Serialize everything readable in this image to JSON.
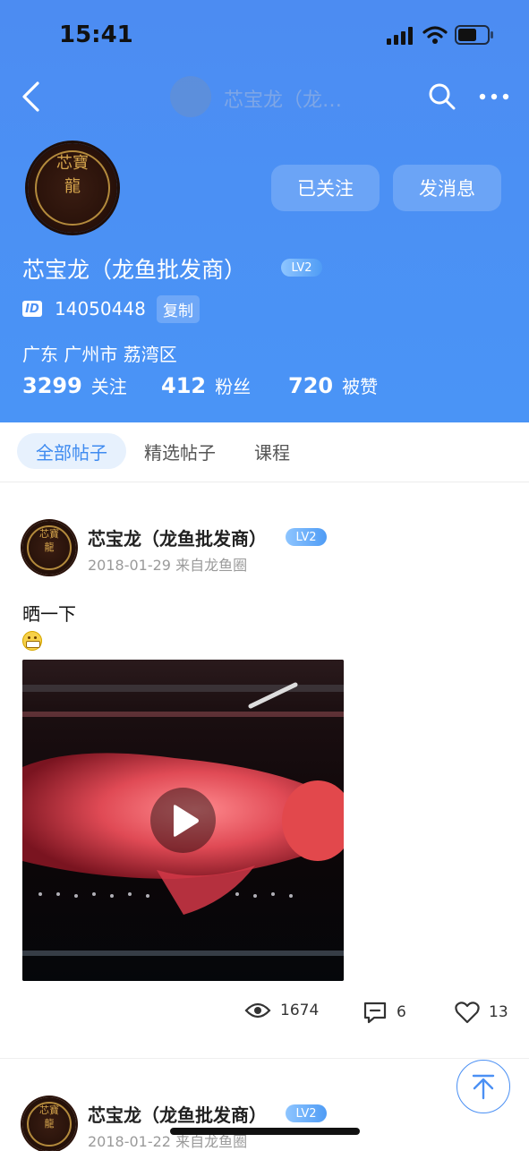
{
  "status_bar": {
    "time": "15:41"
  },
  "nav": {
    "title": "芯宝龙（龙…"
  },
  "profile": {
    "avatar_text": "芯寶龍",
    "follow_button": "已关注",
    "message_button": "发消息",
    "name": "芯宝龙（龙鱼批发商）",
    "level": "LV2",
    "id_label": "ID",
    "id_value": "14050448",
    "copy_label": "复制",
    "location": "广东 广州市 荔湾区",
    "stats": [
      {
        "num": "3299",
        "label": "关注"
      },
      {
        "num": "412",
        "label": "粉丝"
      },
      {
        "num": "720",
        "label": "被赞"
      }
    ]
  },
  "tabs": [
    "全部帖子",
    "精选帖子",
    "课程"
  ],
  "posts": [
    {
      "author": "芯宝龙（龙鱼批发商）",
      "level": "LV2",
      "meta": "2018-01-29 来自龙鱼圈",
      "text": "晒一下",
      "views": "1674",
      "comments": "6",
      "likes": "13"
    },
    {
      "author": "芯宝龙（龙鱼批发商）",
      "level": "LV2",
      "meta": "2018-01-22 来自龙鱼圈"
    }
  ],
  "colors": {
    "header_blue": "#4b90f4",
    "accent": "#3f8bf0"
  },
  "icons": [
    "back-arrow-icon",
    "search-icon",
    "more-icon",
    "play-icon",
    "eye-icon",
    "comment-icon",
    "heart-icon",
    "back-to-top-icon"
  ]
}
